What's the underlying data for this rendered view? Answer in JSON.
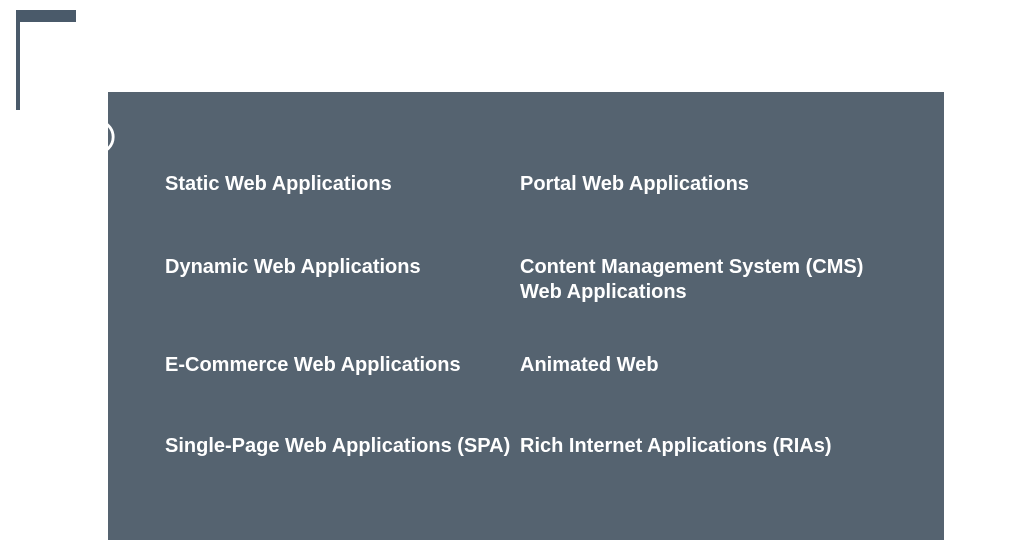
{
  "left_column": [
    "Static Web Applications",
    "Dynamic Web Applications",
    "E-Commerce Web Applications",
    "Single-Page Web Applications (SPA)"
  ],
  "right_column": [
    "Portal Web Applications",
    "Content Management System (CMS)\nWeb Applications",
    "Animated Web",
    "Rich Internet Applications (RIAs)"
  ],
  "colors": {
    "panel": "#556370",
    "accent": "#4a5a6a",
    "text": "#ffffff"
  }
}
